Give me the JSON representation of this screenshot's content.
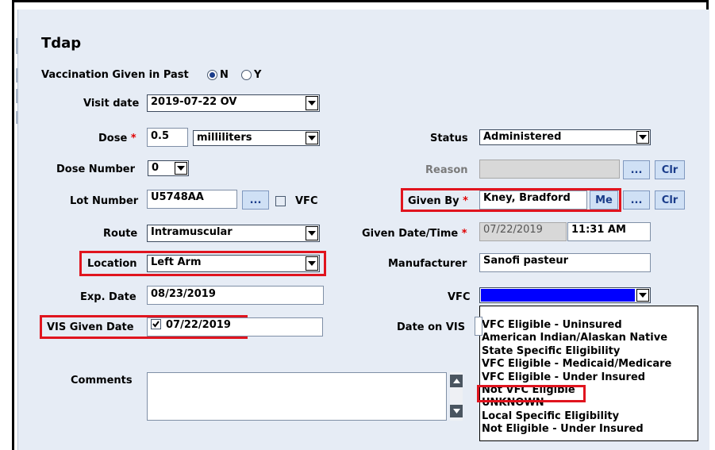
{
  "title": "Tdap",
  "past": {
    "label": "Vaccination Given in Past",
    "opt_n": "N",
    "opt_y": "Y"
  },
  "visit_date": {
    "label": "Visit date",
    "value": "2019-07-22 OV"
  },
  "dose": {
    "label": "Dose",
    "req": "*",
    "amount": "0.5",
    "unit": "milliliters"
  },
  "dose_number": {
    "label": "Dose Number",
    "value": "0"
  },
  "lot_number": {
    "label": "Lot Number",
    "value": "U5748AA",
    "browse": "...",
    "vfc_label": "VFC"
  },
  "route": {
    "label": "Route",
    "value": "Intramuscular"
  },
  "location": {
    "label": "Location",
    "value": "Left Arm"
  },
  "exp_date": {
    "label": "Exp. Date",
    "value": "08/23/2019"
  },
  "vis_given_date": {
    "label": "VIS Given Date",
    "value": "07/22/2019"
  },
  "comments": {
    "label": "Comments"
  },
  "status": {
    "label": "Status",
    "value": "Administered"
  },
  "reason": {
    "label": "Reason",
    "browse": "...",
    "clear": "Clr"
  },
  "given_by": {
    "label": "Given By",
    "req": "*",
    "value": "Kney, Bradford",
    "me": "Me",
    "browse": "...",
    "clear": "Clr"
  },
  "given_datetime": {
    "label": "Given Date/Time",
    "req": "*",
    "date": "07/22/2019",
    "time": "11:31 AM"
  },
  "manufacturer": {
    "label": "Manufacturer",
    "value": "Sanofi pasteur"
  },
  "vfc": {
    "label": "VFC",
    "options": [
      "",
      "VFC Eligible - Uninsured",
      "American Indian/Alaskan Native",
      "State Specific Eligibility",
      "VFC Eligible - Medicaid/Medicare",
      "VFC Eligible - Under Insured",
      "Not VFC Eligible",
      "UNKNOWN",
      "Local Specific Eligibility",
      "Not Eligible - Under Insured"
    ]
  },
  "date_on_vis": {
    "label": "Date on VIS"
  },
  "colors": {
    "highlight": "#e0141e",
    "selected_option": "#0000ff",
    "panel_bg": "#e6ecf5"
  }
}
